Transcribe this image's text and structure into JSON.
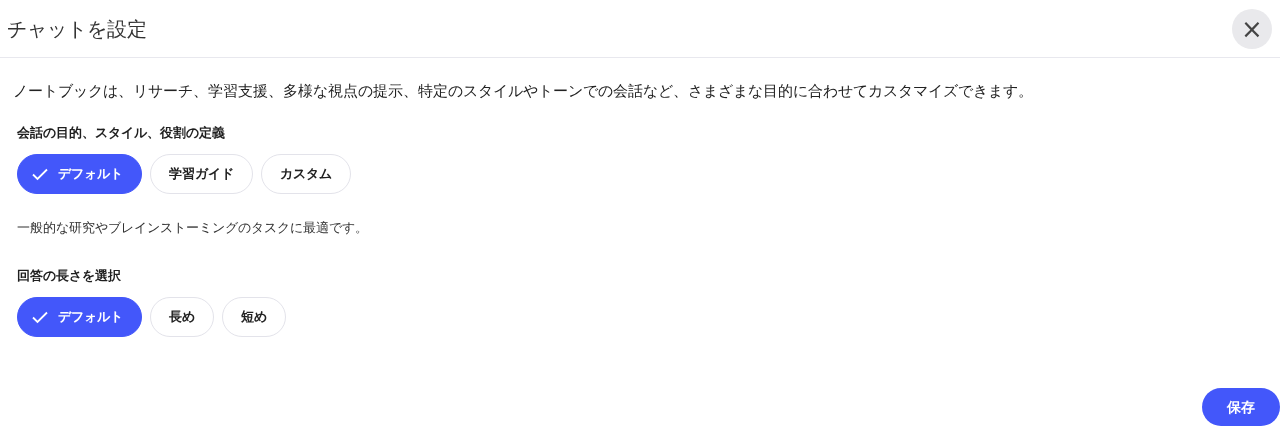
{
  "dialog": {
    "title": "チャットを設定",
    "close_label": "×"
  },
  "description": "ノートブックは、リサーチ、学習支援、多様な視点の提示、特定のスタイルやトーンでの会話など、さまざまな目的に合わせてカスタマイズできます。",
  "sections": [
    {
      "label": "会話の目的、スタイル、役割の定義",
      "options": [
        {
          "label": "デフォルト",
          "selected": true
        },
        {
          "label": "学習ガイド",
          "selected": false
        },
        {
          "label": "カスタム",
          "selected": false
        }
      ],
      "hint": "一般的な研究やブレインストーミングのタスクに最適です。"
    },
    {
      "label": "回答の長さを選択",
      "options": [
        {
          "label": "デフォルト",
          "selected": true
        },
        {
          "label": "長め",
          "selected": false
        },
        {
          "label": "短め",
          "selected": false
        }
      ]
    }
  ],
  "save_button": "保存"
}
